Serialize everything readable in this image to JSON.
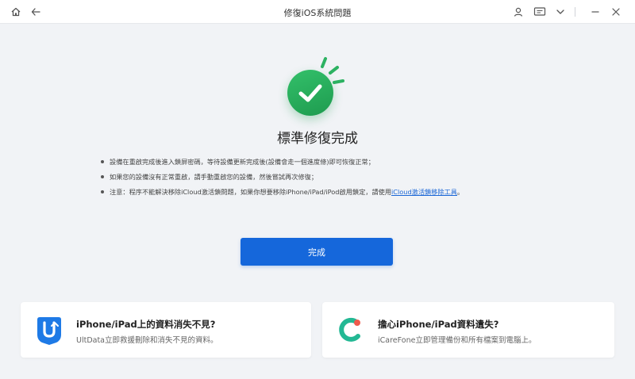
{
  "window": {
    "title": "修復iOS系統問題",
    "icons": {
      "home": "home-icon",
      "back": "back-arrow-icon",
      "account": "user-icon",
      "feedback": "feedback-icon",
      "dropdown": "chevron-down-icon",
      "minimize": "minimize-icon",
      "close": "close-icon"
    }
  },
  "status": {
    "icon": "success-check-icon",
    "title": "標準修復完成",
    "colors": {
      "success": "#2db262",
      "accent": "#1567db"
    }
  },
  "notes": [
    {
      "text": "設備在重啟完成後進入鎖屏密碼，等待設備更新完成後(設備會走一個進度條)即可恢復正常；"
    },
    {
      "text": "如果您的設備沒有正常重啟，請手動重啟您的設備，然後嘗試再次修復；"
    },
    {
      "text_before": "注意：程序不能解決移除iCloud激活鎖問題，如果你想要移除iPhone/iPad/iPod啟用鎖定，請使用",
      "link": "iCloud激活鎖移除工具",
      "text_after": "。"
    }
  ],
  "done_button": {
    "label": "完成"
  },
  "promos": [
    {
      "icon": "ultdata-app-icon",
      "title": "iPhone/iPad上的資料消失不見?",
      "desc": "UltData立即救援刪除和消失不見的資料。"
    },
    {
      "icon": "icarefone-app-icon",
      "title": "擔心iPhone/iPad資料遺失?",
      "desc": "iCareFone立即管理備份和所有檔案到電腦上。"
    }
  ]
}
